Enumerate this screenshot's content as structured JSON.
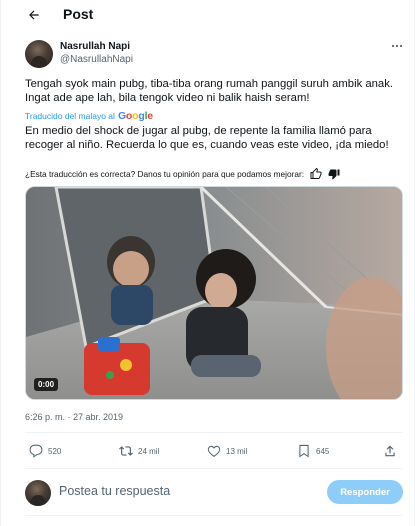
{
  "header": {
    "title": "Post"
  },
  "author": {
    "name": "Nasrullah Napi",
    "handle": "@NasrullahNapi"
  },
  "tweet": {
    "original_text": "Tengah syok main pubg, tiba-tiba orang rumah panggil suruh ambik anak. Ingat ade ape lah, bila tengok video ni balik haish seram!",
    "translated_label": "Traducido del malayo al",
    "translated_provider": "Google",
    "translated_text": "En medio del shock de jugar al pubg, de repente la familia llamó para recoger al niño. Recuerda lo que es, cuando veas este video, ¡da miedo!",
    "feedback_question": "¿Esta traducción es correcta? Danos tu opinión para que podamos mejorar:",
    "video_duration": "0:00",
    "timestamp": "6:26 p. m. · 27 abr. 2019"
  },
  "actions": {
    "replies": "520",
    "retweets": "24 mil",
    "likes": "13 mil",
    "bookmarks": "645"
  },
  "reply": {
    "placeholder": "Postea tu respuesta",
    "button_label": "Responder"
  },
  "colors": {
    "accent": "#1d9bf0",
    "reply_button_disabled": "#8ecdf8",
    "secondary_text": "#536471"
  },
  "icons": {
    "back": "arrow-left-icon",
    "more": "more-horizontal-icon",
    "thumb_up": "thumbs-up-icon",
    "thumb_down": "thumbs-down-icon",
    "reply": "reply-icon",
    "retweet": "retweet-icon",
    "like": "heart-icon",
    "bookmark": "bookmark-icon",
    "share": "share-icon"
  }
}
